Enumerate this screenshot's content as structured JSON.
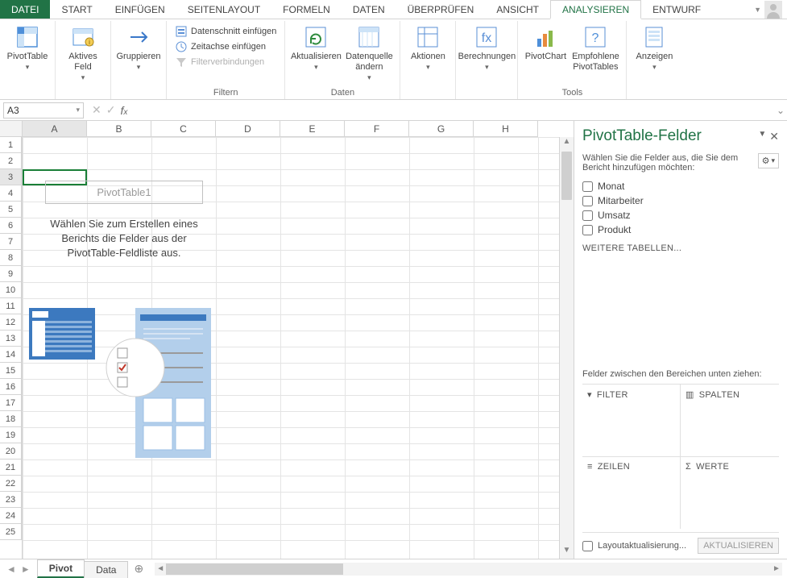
{
  "menu": {
    "file": "DATEI",
    "start": "START",
    "einfuegen": "EINFÜGEN",
    "seitenlayout": "SEITENLAYOUT",
    "formeln": "FORMELN",
    "daten": "DATEN",
    "ueberpruefen": "ÜBERPRÜFEN",
    "ansicht": "ANSICHT",
    "analysieren": "ANALYSIEREN",
    "entwurf": "ENTWURF"
  },
  "ribbon": {
    "pivottable": "PivotTable",
    "aktivesfeld": "Aktives Feld",
    "gruppieren": "Gruppieren",
    "datenschnitt": "Datenschnitt einfügen",
    "zeitachse": "Zeitachse einfügen",
    "filterverb": "Filterverbindungen",
    "filtern_label": "Filtern",
    "aktualisieren": "Aktualisieren",
    "datenquelle": "Datenquelle ändern",
    "daten_label": "Daten",
    "aktionen": "Aktionen",
    "berechnungen": "Berechnungen",
    "pivotchart": "PivotChart",
    "empfohlene": "Empfohlene PivotTables",
    "tools_label": "Tools",
    "anzeigen": "Anzeigen"
  },
  "formula": {
    "namebox": "A3"
  },
  "columns": [
    "A",
    "B",
    "C",
    "D",
    "E",
    "F",
    "G",
    "H"
  ],
  "rows": [
    "1",
    "2",
    "3",
    "4",
    "5",
    "6",
    "7",
    "8",
    "9",
    "10",
    "11",
    "12",
    "13",
    "14",
    "15",
    "16",
    "17",
    "18",
    "19",
    "20",
    "21",
    "22",
    "23",
    "24",
    "25"
  ],
  "pivot": {
    "title": "PivotTable1",
    "hint": "Wählen Sie zum Erstellen eines Berichts die Felder aus der PivotTable-Feldliste aus."
  },
  "panel": {
    "title": "PivotTable-Felder",
    "subtitle": "Wählen Sie die Felder aus, die Sie dem Bericht hinzufügen möchten:",
    "fields": {
      "monat": "Monat",
      "mitarbeiter": "Mitarbeiter",
      "umsatz": "Umsatz",
      "produkt": "Produkt"
    },
    "moretables": "WEITERE TABELLEN...",
    "dragHint": "Felder zwischen den Bereichen unten ziehen:",
    "areas": {
      "filter": "FILTER",
      "spalten": "SPALTEN",
      "zeilen": "ZEILEN",
      "werte": "WERTE"
    },
    "deferLayout": "Layoutaktualisierung...",
    "updateBtn": "AKTUALISIEREN"
  },
  "sheetTabs": {
    "pivot": "Pivot",
    "data": "Data"
  }
}
